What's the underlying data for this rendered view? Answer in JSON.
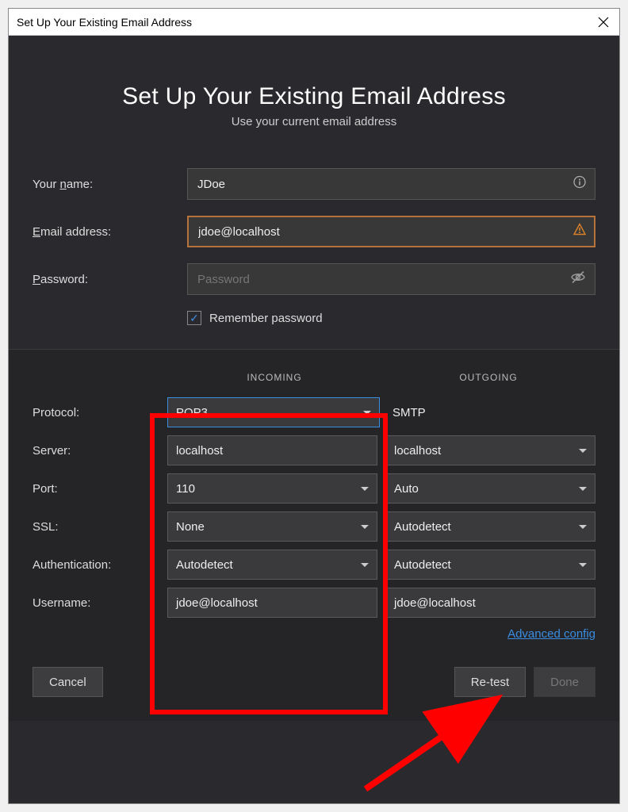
{
  "titlebar": {
    "title": "Set Up Your Existing Email Address"
  },
  "header": {
    "title": "Set Up Your Existing Email Address",
    "subtitle": "Use your current email address"
  },
  "form": {
    "name_label": "Your name:",
    "name_value": "JDoe",
    "email_label": "Email address:",
    "email_value": "jdoe@localhost",
    "password_label": "Password:",
    "password_placeholder": "Password",
    "remember_label": "Remember password",
    "remember_checked": true
  },
  "server": {
    "heading_incoming": "INCOMING",
    "heading_outgoing": "OUTGOING",
    "rows": {
      "protocol_label": "Protocol:",
      "protocol_in": "POP3",
      "protocol_out": "SMTP",
      "server_label": "Server:",
      "server_in": "localhost",
      "server_out": "localhost",
      "port_label": "Port:",
      "port_in": "110",
      "port_out": "Auto",
      "ssl_label": "SSL:",
      "ssl_in": "None",
      "ssl_out": "Autodetect",
      "auth_label": "Authentication:",
      "auth_in": "Autodetect",
      "auth_out": "Autodetect",
      "user_label": "Username:",
      "user_in": "jdoe@localhost",
      "user_out": "jdoe@localhost"
    },
    "advanced_label": "Advanced config"
  },
  "footer": {
    "cancel": "Cancel",
    "retest": "Re-test",
    "done": "Done"
  }
}
